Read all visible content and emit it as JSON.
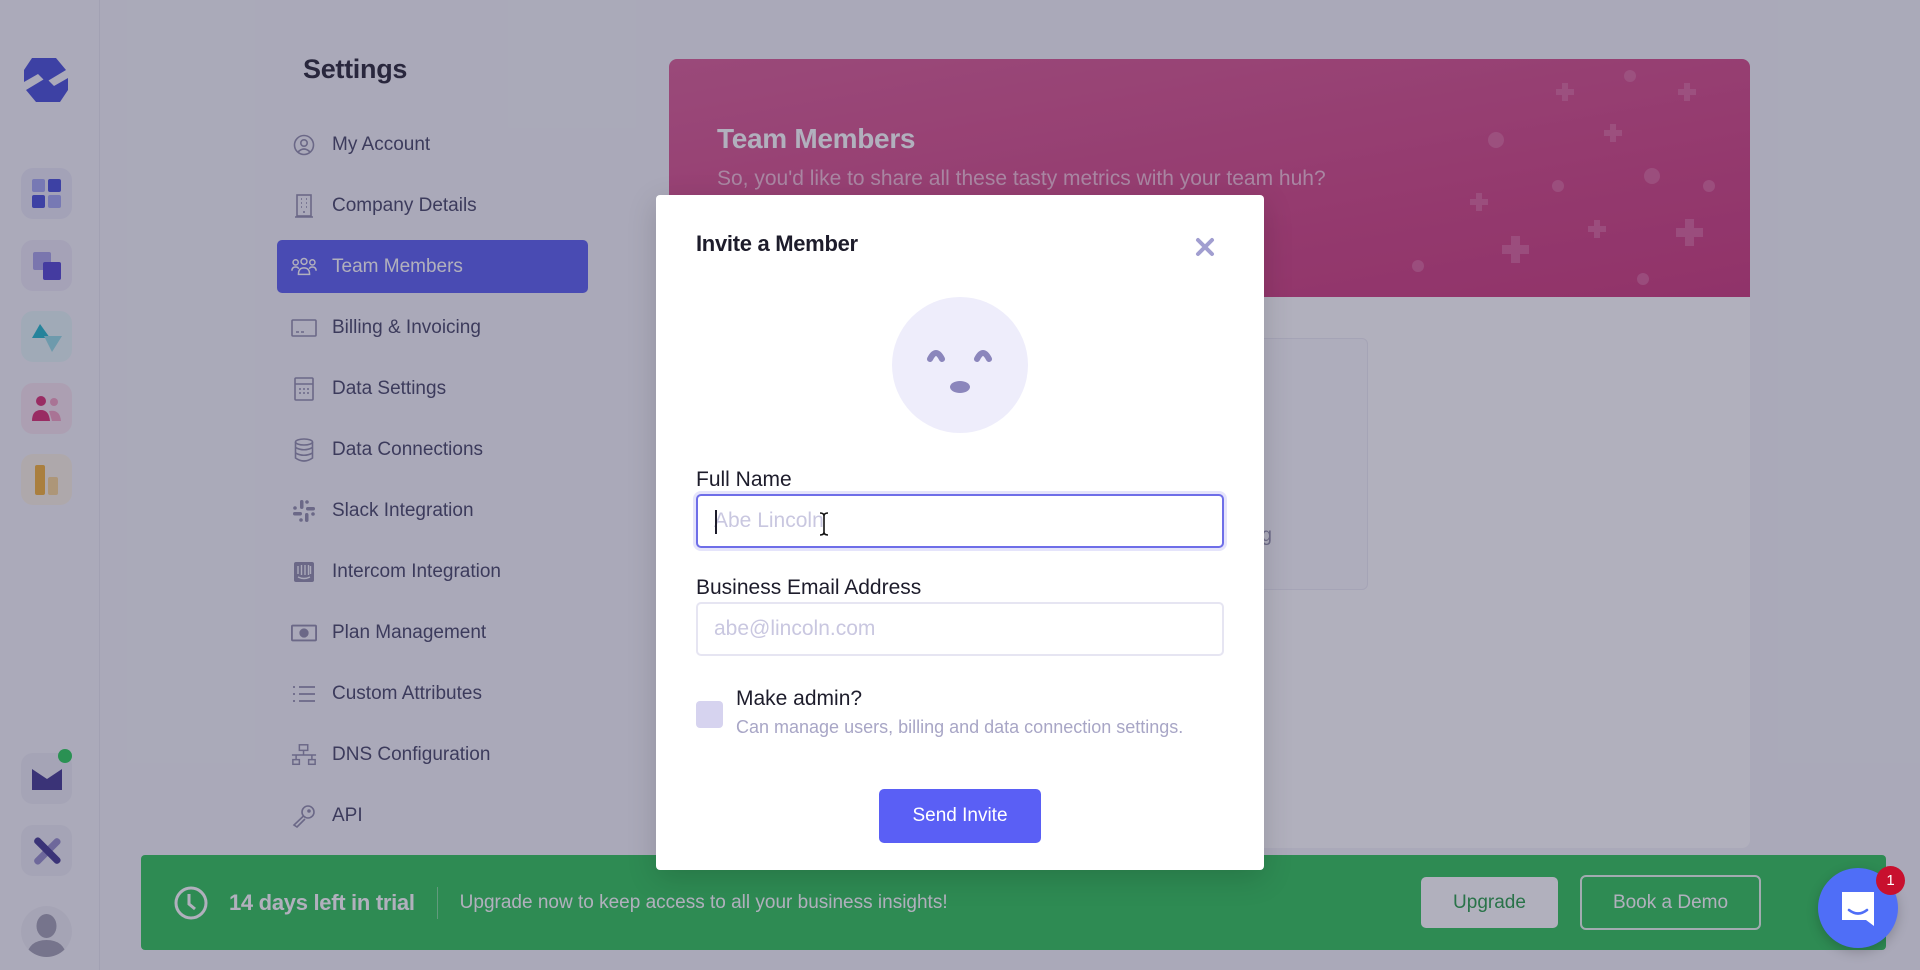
{
  "rail": {
    "logo": "logo-icon",
    "apps": [
      {
        "name": "dashboard-app",
        "icon": "grid-icon",
        "bg": "#e8e8f6"
      },
      {
        "name": "layers-app",
        "icon": "layers-icon",
        "bg": "#ebe8f6"
      },
      {
        "name": "analytics-app",
        "icon": "triangle-pulse-icon",
        "bg": "#e3f6f6"
      },
      {
        "name": "people-app",
        "icon": "people-icon",
        "bg": "#f7e3ed"
      },
      {
        "name": "reports-app",
        "icon": "bar-chart-icon",
        "bg": "#fbf2e2"
      },
      {
        "name": "mail-app",
        "icon": "mail-icon",
        "bg": "#ebebf4"
      },
      {
        "name": "tools-app",
        "icon": "tools-icon",
        "bg": "#ebebf4"
      }
    ],
    "notification_dot_color": "#1ecb4f"
  },
  "settings": {
    "title": "Settings",
    "nav": [
      {
        "label": "My Account",
        "icon": "user-circle-icon",
        "active": false
      },
      {
        "label": "Company Details",
        "icon": "building-icon",
        "active": false
      },
      {
        "label": "Team Members",
        "icon": "team-icon",
        "active": true
      },
      {
        "label": "Billing & Invoicing",
        "icon": "credit-card-icon",
        "active": false
      },
      {
        "label": "Data Settings",
        "icon": "calculator-icon",
        "active": false
      },
      {
        "label": "Data Connections",
        "icon": "database-icon",
        "active": false
      },
      {
        "label": "Slack Integration",
        "icon": "slack-icon",
        "active": false
      },
      {
        "label": "Intercom Integration",
        "icon": "intercom-icon",
        "active": false
      },
      {
        "label": "Plan Management",
        "icon": "money-icon",
        "active": false
      },
      {
        "label": "Custom Attributes",
        "icon": "list-icon",
        "active": false
      },
      {
        "label": "DNS Configuration",
        "icon": "network-icon",
        "active": false
      },
      {
        "label": "API",
        "icon": "key-icon",
        "active": false
      }
    ]
  },
  "hero": {
    "title": "Team Members",
    "subtitle": "So, you'd like to share all these tasty metrics with your team huh?"
  },
  "background_card": {
    "text_fragment": "g"
  },
  "modal": {
    "title": "Invite a Member",
    "close_icon": "close-icon",
    "avatar_icon": "smiley-face-icon",
    "full_name": {
      "label": "Full Name",
      "value": "",
      "placeholder": "Abe Lincoln"
    },
    "email": {
      "label": "Business Email Address",
      "value": "",
      "placeholder": "abe@lincoln.com"
    },
    "make_admin": {
      "label": "Make admin?",
      "help": "Can manage users, billing and data connection settings.",
      "checked": false
    },
    "send_label": "Send Invite"
  },
  "trial_bar": {
    "days_left": "14 days left in trial",
    "message": "Upgrade now to keep access to all your business insights!",
    "upgrade_label": "Upgrade",
    "demo_label": "Book a Demo"
  },
  "chat": {
    "badge_count": "1"
  },
  "colors": {
    "accent": "#5257ee",
    "button": "#5a5ff5",
    "hero_pink": "#d03c7d",
    "trial_green": "#26c24f",
    "chat_blue": "#4f6ef7",
    "badge_red": "#c8102e"
  }
}
